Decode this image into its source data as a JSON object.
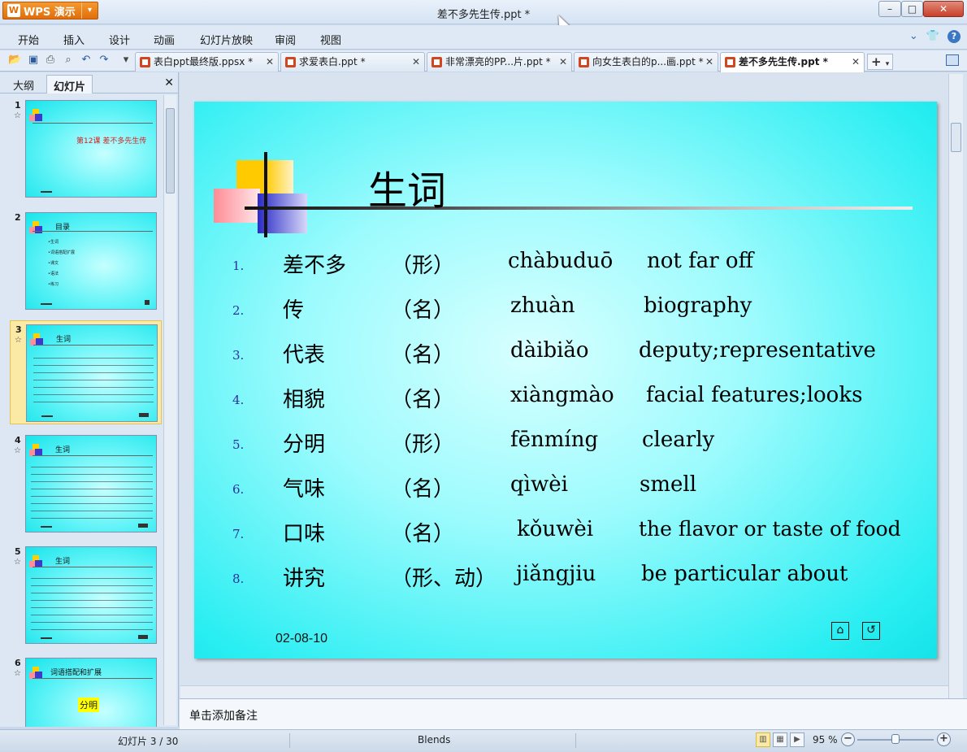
{
  "app": {
    "badge": "WPS 演示",
    "window_title": "差不多先生传.ppt *"
  },
  "menu": [
    "开始",
    "插入",
    "设计",
    "动画",
    "幻灯片放映",
    "审阅",
    "视图"
  ],
  "tabs": [
    {
      "label": "表白ppt最终版.ppsx *",
      "active": false
    },
    {
      "label": "求爱表白.ppt *",
      "active": false
    },
    {
      "label": "非常漂亮的PP...片.ppt *",
      "active": false
    },
    {
      "label": "向女生表白的p...画.ppt *",
      "active": false
    },
    {
      "label": "差不多先生传.ppt *",
      "active": true
    }
  ],
  "panel": {
    "tab_outline": "大纲",
    "tab_slides": "幻灯片"
  },
  "thumbnails": [
    {
      "num": "1",
      "title": "第12课 差不多先生传"
    },
    {
      "num": "2",
      "title": "目录",
      "items": [
        "•生词",
        "•词语搭配扩展",
        "•课文",
        "•语法",
        "•练习"
      ]
    },
    {
      "num": "3",
      "title": "生词"
    },
    {
      "num": "4",
      "title": "生词"
    },
    {
      "num": "5",
      "title": "生词"
    },
    {
      "num": "6",
      "title": "词语搭配和扩展",
      "highlight": "分明"
    }
  ],
  "slide": {
    "title": "生词",
    "date": "02-08-10",
    "rows": [
      {
        "num": "1.",
        "zh": "差不多",
        "pos": "（形）",
        "pinyin": "chàbuduō",
        "en": "not far off"
      },
      {
        "num": "2.",
        "zh": "传",
        "pos": "（名）",
        "pinyin": "zhuàn",
        "en": "biography"
      },
      {
        "num": "3.",
        "zh": "代表",
        "pos": "（名）",
        "pinyin": "dàibiǎo",
        "en": "deputy;representative"
      },
      {
        "num": "4.",
        "zh": "相貌",
        "pos": "（名）",
        "pinyin": "xiàngmào",
        "en": "facial features;looks"
      },
      {
        "num": "5.",
        "zh": "分明",
        "pos": "（形）",
        "pinyin": "fēnmíng",
        "en": "clearly"
      },
      {
        "num": "6.",
        "zh": "气味",
        "pos": "（名）",
        "pinyin": "qìwèi",
        "en": "smell"
      },
      {
        "num": "7.",
        "zh": "口味",
        "pos": "（名）",
        "pinyin": "kǒuwèi",
        "en": "the flavor or taste of  food"
      },
      {
        "num": "8.",
        "zh": "讲究",
        "pos": "（形、动）",
        "pinyin": "jiǎngjiu",
        "en": "be particular about"
      }
    ]
  },
  "notes_placeholder": "单击添加备注",
  "status": {
    "slide_counter": "幻灯片 3 / 30",
    "theme": "Blends",
    "zoom": "95 %",
    "zoom_fraction": 0.5
  }
}
